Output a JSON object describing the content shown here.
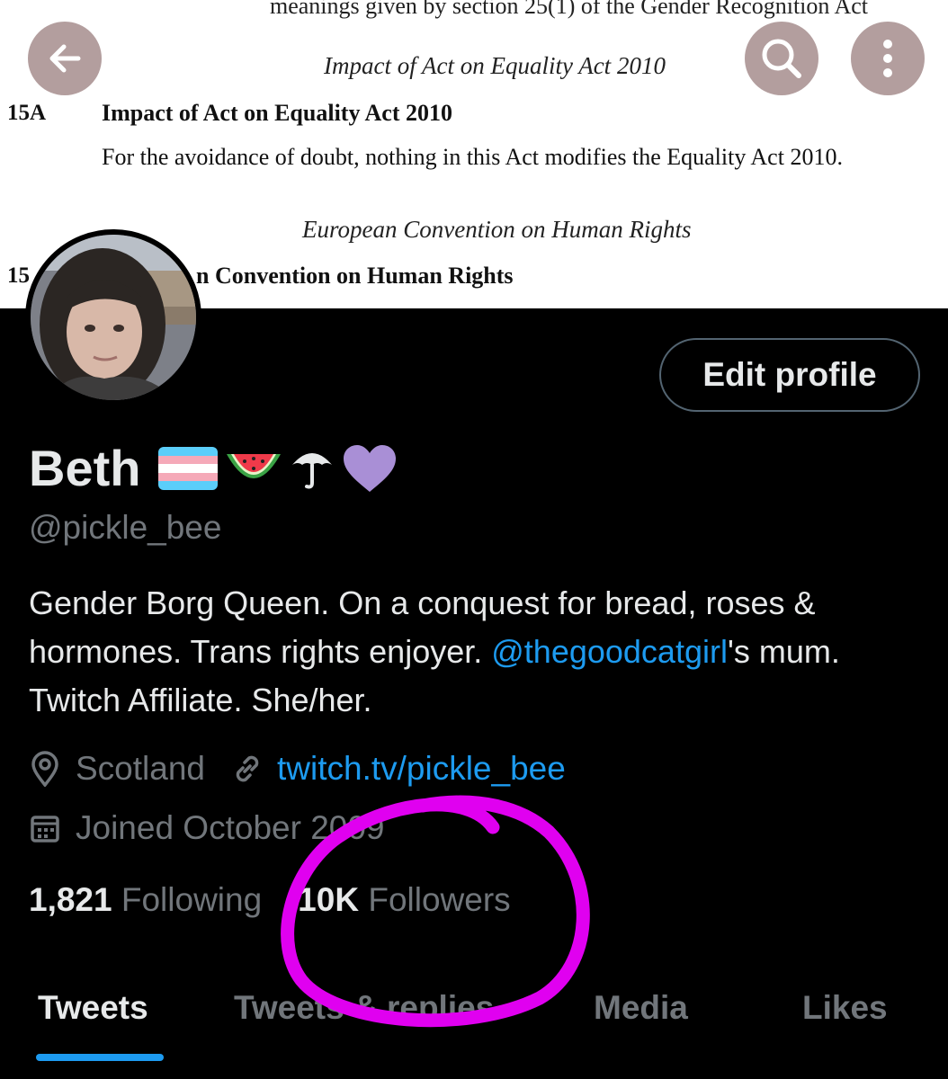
{
  "document": {
    "clipped_line": "meanings given by section 25(1) of the Gender Recognition Act",
    "section1_caption": "Impact of Act on Equality Act 2010",
    "section1_number": "15A",
    "section1_heading": "Impact of Act on Equality Act 2010",
    "section1_body": "For the avoidance of doubt, nothing in this Act modifies the Equality Act 2010.",
    "section2_caption": "European Convention on Human Rights",
    "section2_number": "15",
    "section2_heading": "n Convention on Human Rights"
  },
  "header_buttons": {
    "back_icon": "arrow-left-icon",
    "search_icon": "search-icon",
    "more_icon": "more-vertical-icon"
  },
  "profile": {
    "edit_label": "Edit profile",
    "name": "Beth",
    "name_emojis": [
      "transgender-flag",
      "watermelon",
      "umbrella",
      "purple-heart"
    ],
    "handle": "@pickle_bee",
    "bio_part1": "Gender Borg Queen. On a conquest for bread, roses & hormones. Trans rights enjoyer. ",
    "bio_mention": "@thegoodcatgirl",
    "bio_part2": "'s mum. Twitch Affiliate. She/her.",
    "location": "Scotland",
    "website": "twitch.tv/pickle_bee",
    "joined": "Joined October 2009",
    "following_count": "1,821",
    "following_label": "Following",
    "followers_count": "10K",
    "followers_label": "Followers"
  },
  "tabs": [
    {
      "label": "Tweets",
      "active": true
    },
    {
      "label": "Tweets & replies",
      "active": false
    },
    {
      "label": "Media",
      "active": false
    },
    {
      "label": "Likes",
      "active": false
    }
  ],
  "colors": {
    "background": "#000000",
    "accent": "#1d9bf0",
    "secondary_text": "#71767b",
    "annotation": "#e000f0"
  }
}
